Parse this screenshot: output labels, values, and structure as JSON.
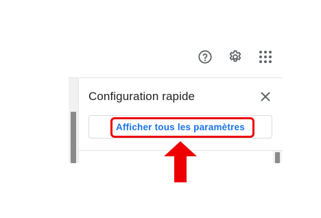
{
  "toolbar": {
    "help_icon": "help-circle-icon",
    "settings_icon": "gear-icon",
    "apps_icon": "apps-grid-icon"
  },
  "quick_settings": {
    "title": "Configuration rapide",
    "close_icon": "close-icon",
    "see_all_label": "Afficher tous les paramètres"
  },
  "annotation": {
    "highlight_color": "#ee0000",
    "arrow_direction": "up"
  },
  "colors": {
    "link_blue": "#1a73e8",
    "icon_gray": "#5f6368",
    "title_text": "#202124"
  }
}
